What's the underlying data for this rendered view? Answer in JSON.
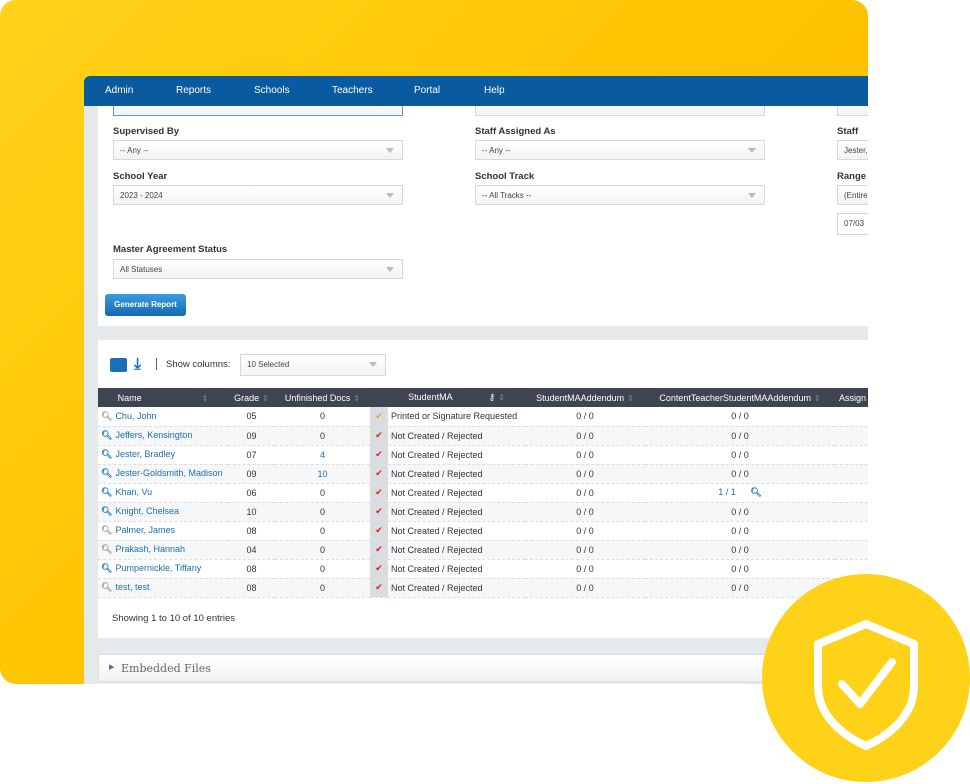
{
  "nav": [
    "Admin",
    "Reports",
    "Schools",
    "Teachers",
    "Portal",
    "Help"
  ],
  "filters": {
    "supervised_by": {
      "label": "Supervised By",
      "value": "-- Any --"
    },
    "staff_assigned_as": {
      "label": "Staff Assigned As",
      "value": "-- Any --"
    },
    "staff": {
      "label": "Staff",
      "value": "Jester,"
    },
    "school_year": {
      "label": "School Year",
      "value": "2023 - 2024"
    },
    "school_track": {
      "label": "School Track",
      "value": "-- All Tracks --"
    },
    "range": {
      "label": "Range",
      "value": "(Entire",
      "date": "07/03"
    },
    "ma_status": {
      "label": "Master Agreement Status",
      "value": "All Statuses"
    }
  },
  "generate_label": "Generate Report",
  "toolbar": {
    "show_columns_label": "Show columns:",
    "show_columns_value": "10 Selected"
  },
  "columns": [
    "Name",
    "Grade",
    "Unfinished Docs",
    "StudentMA",
    "StudentMAAddendum",
    "ContentTeacherStudentMAAddendum",
    "Assign"
  ],
  "rows": [
    {
      "name": "Chu, John",
      "grade": "05",
      "docs": "0",
      "check": "orange",
      "ma": "Printed or Signature Requested",
      "add": "0 / 0",
      "cont": "0 / 0",
      "icon": "gray"
    },
    {
      "name": "Jeffers, Kensington",
      "grade": "09",
      "docs": "0",
      "check": "red",
      "ma": "Not Created / Rejected",
      "add": "0 / 0",
      "cont": "0 / 0",
      "icon": "blue"
    },
    {
      "name": "Jester, Bradley",
      "grade": "07",
      "docs": "4",
      "check": "red",
      "ma": "Not Created / Rejected",
      "add": "0 / 0",
      "cont": "0 / 0",
      "icon": "blue"
    },
    {
      "name": "Jester-Goldsmith, Madison",
      "grade": "09",
      "docs": "10",
      "check": "red",
      "ma": "Not Created / Rejected",
      "add": "0 / 0",
      "cont": "0 / 0",
      "icon": "blue"
    },
    {
      "name": "Khan, Vu",
      "grade": "06",
      "docs": "0",
      "check": "red",
      "ma": "Not Created / Rejected",
      "add": "0 / 0",
      "cont": "1 / 1",
      "icon": "blue"
    },
    {
      "name": "Knight, Chelsea",
      "grade": "10",
      "docs": "0",
      "check": "red",
      "ma": "Not Created / Rejected",
      "add": "0 / 0",
      "cont": "0 / 0",
      "icon": "blue"
    },
    {
      "name": "Palmer, James",
      "grade": "08",
      "docs": "0",
      "check": "red",
      "ma": "Not Created / Rejected",
      "add": "0 / 0",
      "cont": "0 / 0",
      "icon": "gray"
    },
    {
      "name": "Prakash, Hannah",
      "grade": "04",
      "docs": "0",
      "check": "red",
      "ma": "Not Created / Rejected",
      "add": "0 / 0",
      "cont": "0 / 0",
      "icon": "gray"
    },
    {
      "name": "Pumpernickle, Tiffany",
      "grade": "08",
      "docs": "0",
      "check": "red",
      "ma": "Not Created / Rejected",
      "add": "0 / 0",
      "cont": "0 / 0",
      "icon": "blue"
    },
    {
      "name": "test, test",
      "grade": "08",
      "docs": "0",
      "check": "red",
      "ma": "Not Created / Rejected",
      "add": "0 / 0",
      "cont": "0 / 0",
      "icon": "gray"
    }
  ],
  "showing": "Showing 1 to 10 of 10 entries",
  "embedded_files": "Embedded Files",
  "colors": {
    "nav": "#0a5aa0",
    "link": "#1a6fb5",
    "brand_yellow": "#ffd21a",
    "check_red": "#e11",
    "check_orange": "#f0a020"
  }
}
